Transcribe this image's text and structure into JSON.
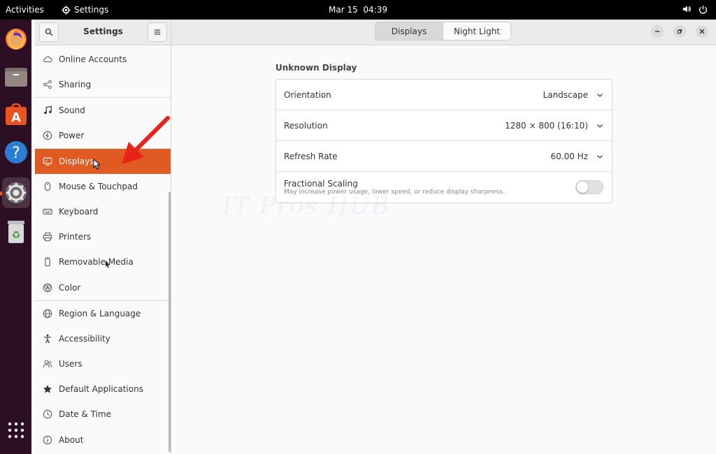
{
  "topbar": {
    "activities": "Activities",
    "app_name": "Settings",
    "date": "Mar 15",
    "time": "04:39"
  },
  "dock": {
    "items": [
      "firefox-icon",
      "files-icon",
      "app-center-icon",
      "help-icon",
      "settings-icon",
      "trash-icon",
      "show-apps-icon"
    ]
  },
  "window": {
    "title": "Settings",
    "tabs": [
      {
        "label": "Displays",
        "selected": true
      },
      {
        "label": "Night Light",
        "selected": false
      }
    ]
  },
  "sidebar": {
    "items": [
      {
        "label": "Online Accounts",
        "icon": "cloud-icon"
      },
      {
        "label": "Sharing",
        "icon": "share-icon"
      },
      {
        "label": "Sound",
        "icon": "music-note-icon"
      },
      {
        "label": "Power",
        "icon": "power-icon"
      },
      {
        "label": "Displays",
        "icon": "display-icon",
        "selected": true
      },
      {
        "label": "Mouse & Touchpad",
        "icon": "mouse-icon"
      },
      {
        "label": "Keyboard",
        "icon": "keyboard-icon"
      },
      {
        "label": "Printers",
        "icon": "printer-icon"
      },
      {
        "label": "Removable Media",
        "icon": "removable-media-icon"
      },
      {
        "label": "Color",
        "icon": "color-icon"
      },
      {
        "label": "Region & Language",
        "icon": "globe-icon"
      },
      {
        "label": "Accessibility",
        "icon": "accessibility-icon"
      },
      {
        "label": "Users",
        "icon": "users-icon"
      },
      {
        "label": "Default Applications",
        "icon": "star-icon"
      },
      {
        "label": "Date & Time",
        "icon": "clock-icon"
      },
      {
        "label": "About",
        "icon": "info-icon"
      }
    ]
  },
  "display": {
    "name": "Unknown Display",
    "orientation": {
      "label": "Orientation",
      "value": "Landscape"
    },
    "resolution": {
      "label": "Resolution",
      "value": "1280 × 800 (16:10)"
    },
    "refresh_rate": {
      "label": "Refresh Rate",
      "value": "60.00 Hz"
    },
    "fractional_scaling": {
      "label": "Fractional Scaling",
      "description": "May increase power usage, lower speed, or reduce display sharpness.",
      "enabled": false
    }
  },
  "watermark": "IT Pros HUB",
  "colors": {
    "accent": "#e05a23",
    "dock": "#2c0f22",
    "topbar": "#000000",
    "arrow": "#e8231a"
  }
}
